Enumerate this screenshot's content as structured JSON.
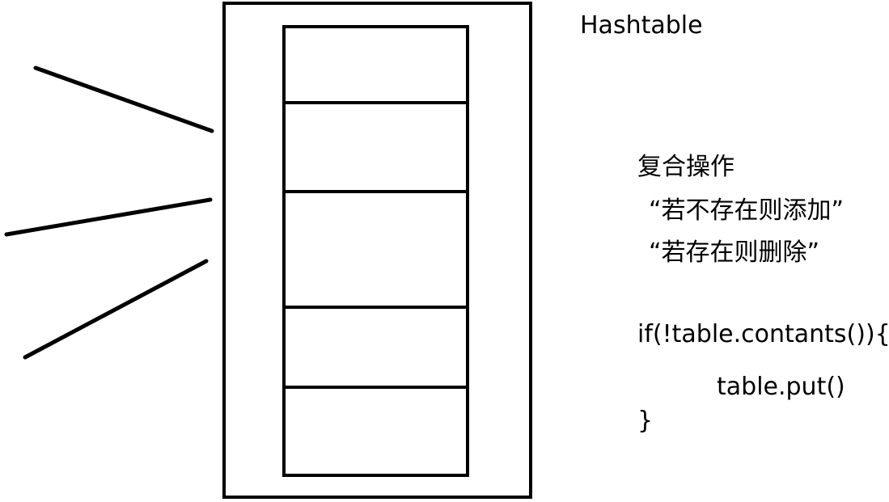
{
  "title": "Hashtable",
  "compound_ops": {
    "heading": "复合操作",
    "items": [
      "“若不存在则添加”",
      "“若存在则删除”"
    ]
  },
  "code": {
    "line1": "if(!table.contants()){",
    "line2": "table.put()",
    "line3": "}"
  },
  "colors": {
    "stroke": "#000000",
    "background": "#ffffff"
  }
}
